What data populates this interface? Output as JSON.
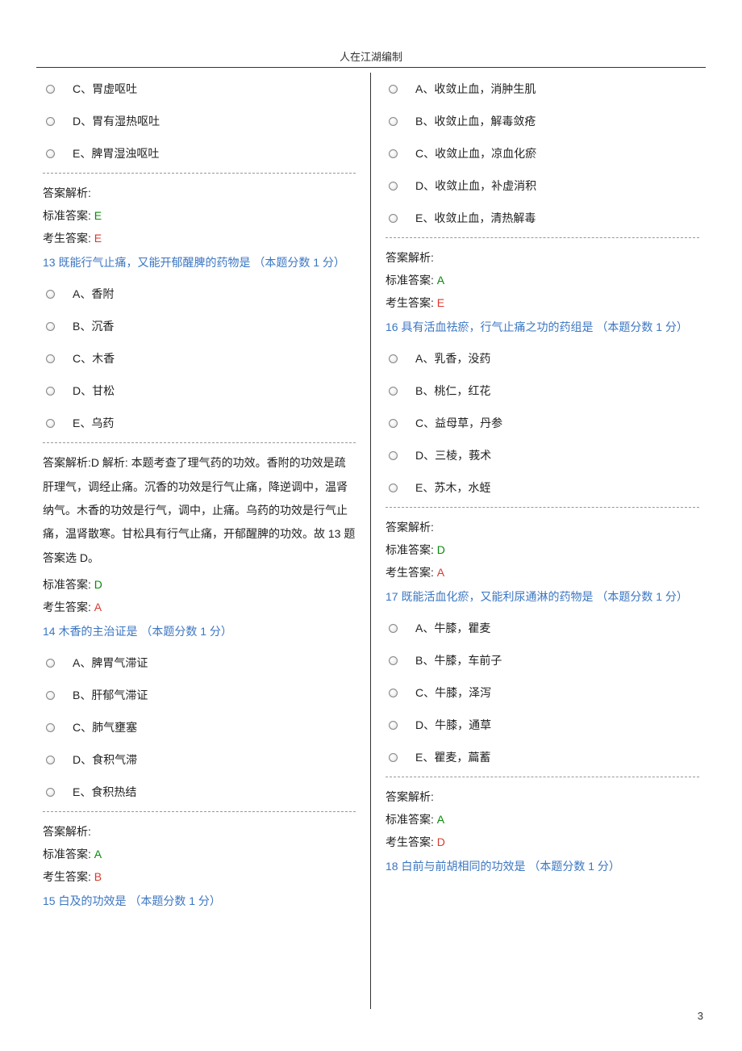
{
  "header": "人在江湖编制",
  "page_number": "3",
  "left": {
    "q12_opts": {
      "c": "C、胃虚呕吐",
      "d": "D、胃有湿热呕吐",
      "e": "E、脾胃湿浊呕吐"
    },
    "q12_ans": {
      "label_analysis": "答案解析:",
      "label_standard": "标准答案:",
      "standard": "E",
      "label_candidate": "考生答案:",
      "candidate": "E"
    },
    "q13": {
      "text": "13 既能行气止痛，又能开郁醒脾的药物是 （本题分数 1 分）",
      "opts": {
        "a": "A、香附",
        "b": "B、沉香",
        "c": "C、木香",
        "d": "D、甘松",
        "e": "E、乌药"
      },
      "ans": {
        "label_analysis": "答案解析:",
        "explain": "D 解析: 本题考查了理气药的功效。香附的功效是疏肝理气，调经止痛。沉香的功效是行气止痛，降逆调中，温肾纳气。木香的功效是行气，调中，止痛。乌药的功效是行气止痛，温肾散寒。甘松具有行气止痛，开郁醒脾的功效。故 13 题答案选 D。",
        "label_standard": "标准答案:",
        "standard": "D",
        "label_candidate": "考生答案:",
        "candidate": "A"
      }
    },
    "q14": {
      "text": "14 木香的主治证是 （本题分数 1 分）",
      "opts": {
        "a": "A、脾胃气滞证",
        "b": "B、肝郁气滞证",
        "c": "C、肺气壅塞",
        "d": "D、食积气滞",
        "e": "E、食积热结"
      },
      "ans": {
        "label_analysis": "答案解析:",
        "label_standard": "标准答案:",
        "standard": "A",
        "label_candidate": "考生答案:",
        "candidate": "B"
      }
    },
    "q15": {
      "text": "15 白及的功效是 （本题分数 1 分）"
    }
  },
  "right": {
    "q15_opts": {
      "a": "A、收敛止血，消肿生肌",
      "b": "B、收敛止血，解毒敛疮",
      "c": "C、收敛止血，凉血化瘀",
      "d": "D、收敛止血，补虚消积",
      "e": "E、收敛止血，清热解毒"
    },
    "q15_ans": {
      "label_analysis": "答案解析:",
      "label_standard": "标准答案:",
      "standard": "A",
      "label_candidate": "考生答案:",
      "candidate": "E"
    },
    "q16": {
      "text": "16 具有活血祛瘀，行气止痛之功的药组是 （本题分数 1 分）",
      "opts": {
        "a": "A、乳香，没药",
        "b": "B、桃仁，红花",
        "c": "C、益母草，丹参",
        "d": "D、三棱，莪术",
        "e": "E、苏木，水蛭"
      },
      "ans": {
        "label_analysis": "答案解析:",
        "label_standard": "标准答案:",
        "standard": "D",
        "label_candidate": "考生答案:",
        "candidate": "A"
      }
    },
    "q17": {
      "text": "17 既能活血化瘀，又能利尿通淋的药物是 （本题分数 1 分）",
      "opts": {
        "a": "A、牛膝，瞿麦",
        "b": "B、牛膝，车前子",
        "c": "C、牛膝，泽泻",
        "d": "D、牛膝，通草",
        "e": "E、瞿麦，萹蓄"
      },
      "ans": {
        "label_analysis": "答案解析:",
        "label_standard": "标准答案:",
        "standard": "A",
        "label_candidate": "考生答案:",
        "candidate": "D"
      }
    },
    "q18": {
      "text": "18 白前与前胡相同的功效是 （本题分数 1 分）"
    }
  }
}
